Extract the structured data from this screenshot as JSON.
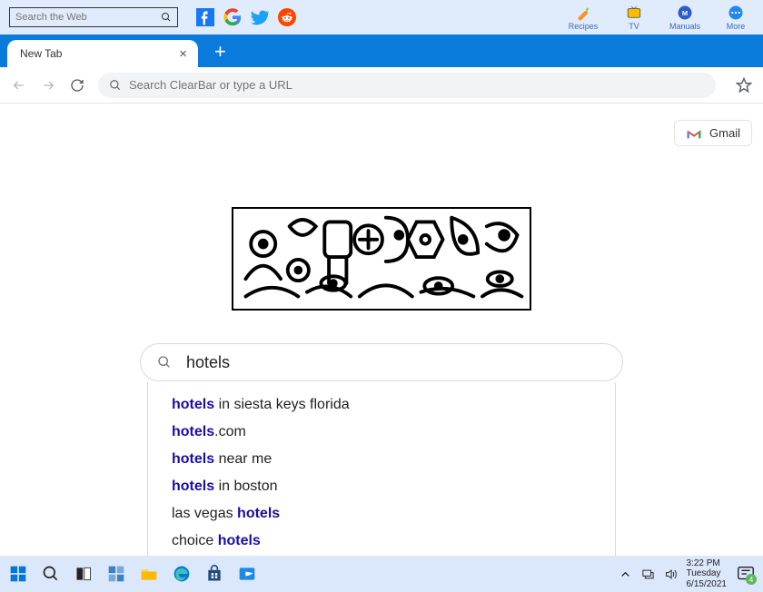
{
  "ribbon": {
    "search_placeholder": "Search the Web",
    "bookmarks": [
      {
        "label": "Recipes"
      },
      {
        "label": "TV"
      },
      {
        "label": "Manuals"
      },
      {
        "label": "More"
      }
    ]
  },
  "tabs": {
    "active_label": "New Tab"
  },
  "toolbar": {
    "omnibox_placeholder": "Search ClearBar or type a URL"
  },
  "page": {
    "gmail_label": "Gmail",
    "search_value": "hotels",
    "suggestions": [
      {
        "pre": "",
        "bold": "hotels",
        "post": " in siesta keys florida"
      },
      {
        "pre": "",
        "bold": "hotels",
        "post": ".com"
      },
      {
        "pre": "",
        "bold": "hotels",
        "post": " near me"
      },
      {
        "pre": "",
        "bold": "hotels",
        "post": " in boston"
      },
      {
        "pre": "las vegas ",
        "bold": "hotels",
        "post": ""
      },
      {
        "pre": "choice ",
        "bold": "hotels",
        "post": ""
      }
    ]
  },
  "taskbar": {
    "time": "3:22 PM",
    "day": "Tuesday",
    "date": "6/15/2021",
    "notif_count": "4"
  }
}
